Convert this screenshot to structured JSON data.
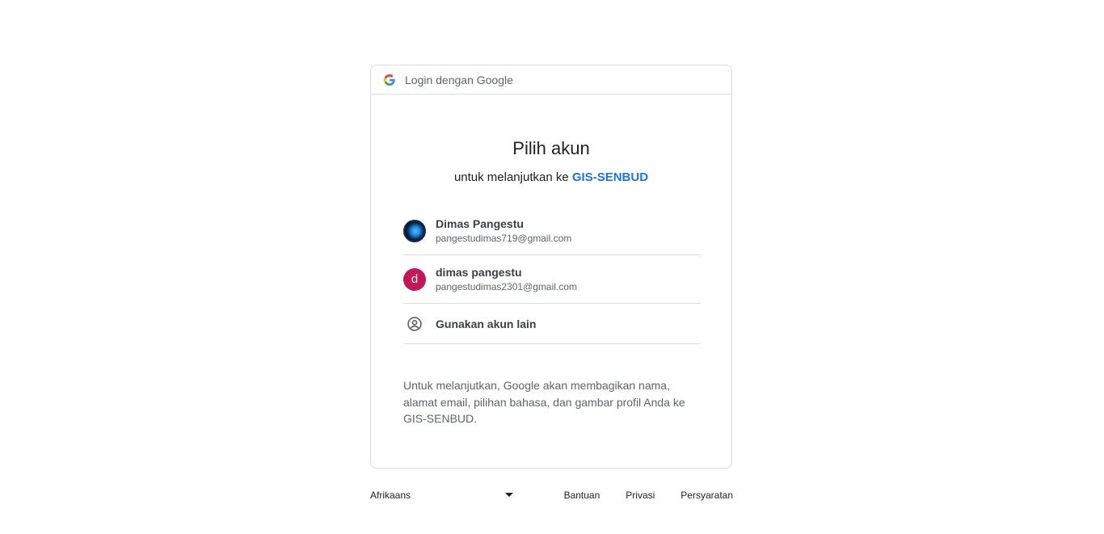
{
  "header": {
    "text": "Login dengan Google",
    "icon": "google-g-icon"
  },
  "main": {
    "title": "Pilih akun",
    "subtitle_prefix": "untuk melanjutkan ke ",
    "app_name": "GIS-SENBUD"
  },
  "accounts": [
    {
      "name": "Dimas Pangestu",
      "email": "pangestudimas719@gmail.com",
      "avatar": "photo"
    },
    {
      "name": "dimas pangestu",
      "email": "pangestudimas2301@gmail.com",
      "avatar_letter": "d",
      "avatar_color": "#c2185b"
    }
  ],
  "other_account": {
    "label": "Gunakan akun lain",
    "icon": "account-circle-icon"
  },
  "disclosure": "Untuk melanjutkan, Google akan membagikan nama, alamat email, pilihan bahasa, dan gambar profil Anda ke GIS-SENBUD.",
  "footer": {
    "language": "Afrikaans",
    "links": [
      "Bantuan",
      "Privasi",
      "Persyaratan"
    ]
  },
  "colors": {
    "accent": "#1a73e8",
    "border": "#dadce0"
  }
}
